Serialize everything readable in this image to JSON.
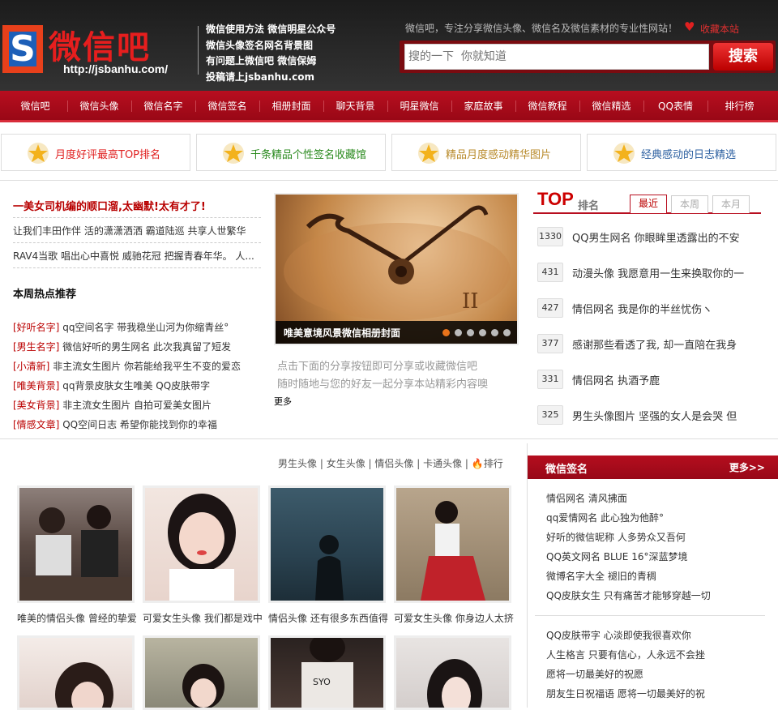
{
  "header": {
    "logo_text": "微信吧",
    "logo_url": "http://jsbanhu.com/",
    "links": [
      "微信使用方法",
      "微信明星公众号",
      "微信头像签名网名背景图",
      "有问题上微信吧",
      "微信保姆",
      "投稿请上jsbanhu.com"
    ],
    "slogan": "微信吧，专注分享微信头像、微信名及微信素材的专业性网站！",
    "favorite": "收藏本站",
    "search_placeholder": "搜的一下  你就知道",
    "search_button": "搜索"
  },
  "nav": [
    "微信吧",
    "微信头像",
    "微信名字",
    "微信签名",
    "相册封面",
    "聊天背景",
    "明星微信",
    "家庭故事",
    "微信教程",
    "微信精选",
    "QQ表情",
    "排行榜"
  ],
  "features": [
    {
      "label": "月度好评最高TOP排名",
      "color": "#e02020"
    },
    {
      "label": "千条精品个性签名收藏馆",
      "color": "#2a8a1e"
    },
    {
      "label": "精品月度感动精华图片",
      "color": "#b88a2a"
    },
    {
      "label": "经典感动的日志精选",
      "color": "#2b5fa0"
    }
  ],
  "news": {
    "headline": "一美女司机编的顺口溜,太幽默!太有才了!",
    "lines": [
      "让我们丰田作伴 活的潇潇洒洒 霸道陆巡 共享人世繁华",
      "RAV4当歌 唱出心中喜悦 威驰花冠 把握青春年华。 人..."
    ],
    "section_title": "本周热点推荐",
    "hot": [
      {
        "tag": "[好听名字]",
        "text": "qq空间名字 带我稳坐山河为你缩青丝°"
      },
      {
        "tag": "[男生名字]",
        "text": "微信好听的男生网名 此次我真留了短发"
      },
      {
        "tag": "[小清新]",
        "text": "非主流女生图片 你若能给我平生不变的爱恋"
      },
      {
        "tag": "[唯美背景]",
        "text": "qq背景皮肤女生唯美 QQ皮肤带字"
      },
      {
        "tag": "[美女背景]",
        "text": "非主流女生图片 自拍可爱美女图片"
      },
      {
        "tag": "[情感文章]",
        "text": "QQ空间日志 希望你能找到你的幸福"
      }
    ]
  },
  "slider": {
    "caption": "唯美意境风景微信相册封面",
    "share_lines": [
      "点击下面的分享按钮即可分享或收藏微信吧",
      "随时随地与您的好友一起分享本站精彩内容噢"
    ],
    "more": "更多"
  },
  "top": {
    "title": "TOP",
    "subtitle": "排名",
    "tabs": [
      "最近",
      "本周",
      "本月"
    ],
    "items": [
      {
        "count": "1330",
        "title": "QQ男生网名 你眼眸里透露出的不安"
      },
      {
        "count": "431",
        "title": "动漫头像 我愿意用一生来换取你的一"
      },
      {
        "count": "427",
        "title": "情侣网名 我是你的半丝忧伤ヽ"
      },
      {
        "count": "377",
        "title": "感谢那些看透了我, 却一直陪在我身"
      },
      {
        "count": "331",
        "title": "情侣网名 执酒予鹿"
      },
      {
        "count": "325",
        "title": "男生头像图片 坚强的女人是会哭 但"
      }
    ]
  },
  "photos": {
    "tabs": [
      "男生头像",
      "女生头像",
      "情侣头像",
      "卡通头像"
    ],
    "rank_label": "排行",
    "captions": [
      "唯美的情侣头像 曾经的挚爱",
      "可爱女生头像 我们都是戏中",
      "情侣头像 还有很多东西值得",
      "可爱女生头像 你身边人太挤"
    ]
  },
  "sidebar": {
    "title": "微信签名",
    "more": "更多>>",
    "items": [
      "情侣网名 清风拂面",
      "qq爱情网名 此心独为他醉°",
      "好听的微信昵称 人多势众又吾何",
      "QQ英文网名 BLUE 16°深蓝梦境",
      "微博名字大全 褪旧的青稠",
      "QQ皮肤女生 只有痛苦才能够穿越一切"
    ],
    "items2": [
      "QQ皮肤带字 心淡即使我很喜欢你",
      "人生格言 只要有信心，人永远不会挫",
      "愿将一切最美好的祝愿",
      "朋友生日祝福语 愿将一切最美好的祝"
    ]
  }
}
